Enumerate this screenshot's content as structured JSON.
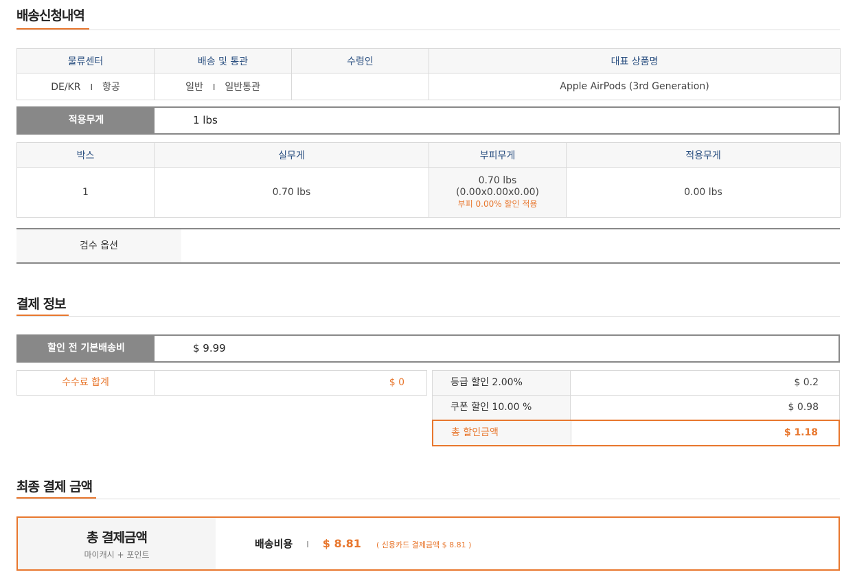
{
  "shipping_section": {
    "title": "배송신청내역"
  },
  "info_table": {
    "headers": [
      "물류센터",
      "배송 및 통관",
      "수령인",
      "대표 상품명"
    ],
    "center_a": "DE/KR",
    "center_b": "항공",
    "type_a": "일반",
    "type_b": "일반통관",
    "recipient": "",
    "product": "Apple AirPods (3rd Generation)",
    "separator": "I"
  },
  "applied_weight": {
    "label": "적용무게",
    "value": "1 lbs"
  },
  "box_table": {
    "headers": [
      "박스",
      "실무게",
      "부피무게",
      "적용무게"
    ],
    "box": "1",
    "actual": "0.70 lbs",
    "volume_line1": "0.70 lbs",
    "volume_line2": "(0.00x0.00x0.00)",
    "volume_note": "부피 0.00% 할인 적용",
    "applied": "0.00 lbs"
  },
  "inspection": {
    "label": "검수 옵션"
  },
  "payment_section": {
    "title": "결제 정보"
  },
  "pre_discount": {
    "label": "할인 전 기본배송비",
    "value": "$ 9.99"
  },
  "fee_total": {
    "label": "수수료 합계",
    "value": "$ 0"
  },
  "discounts": {
    "grade_label": "등급 할인 2.00%",
    "grade_value": "$ 0.2",
    "coupon_label": "쿠폰 할인 10.00 %",
    "coupon_value": "$ 0.98",
    "total_label": "총 할인금액",
    "total_value": "$ 1.18"
  },
  "final_section": {
    "title": "최종 결제 금액"
  },
  "final_payment": {
    "title": "총 결제금액",
    "subtitle": "마이캐시 + 포인트",
    "fee_label": "배송비용",
    "separator": "I",
    "amount": "$ 8.81",
    "card_note": "( 신용카드 결제금액 $ 8.81 )"
  },
  "colors": {
    "accent": "#e8772e",
    "gray_label": "#888888",
    "header_text": "#2a4f80"
  }
}
